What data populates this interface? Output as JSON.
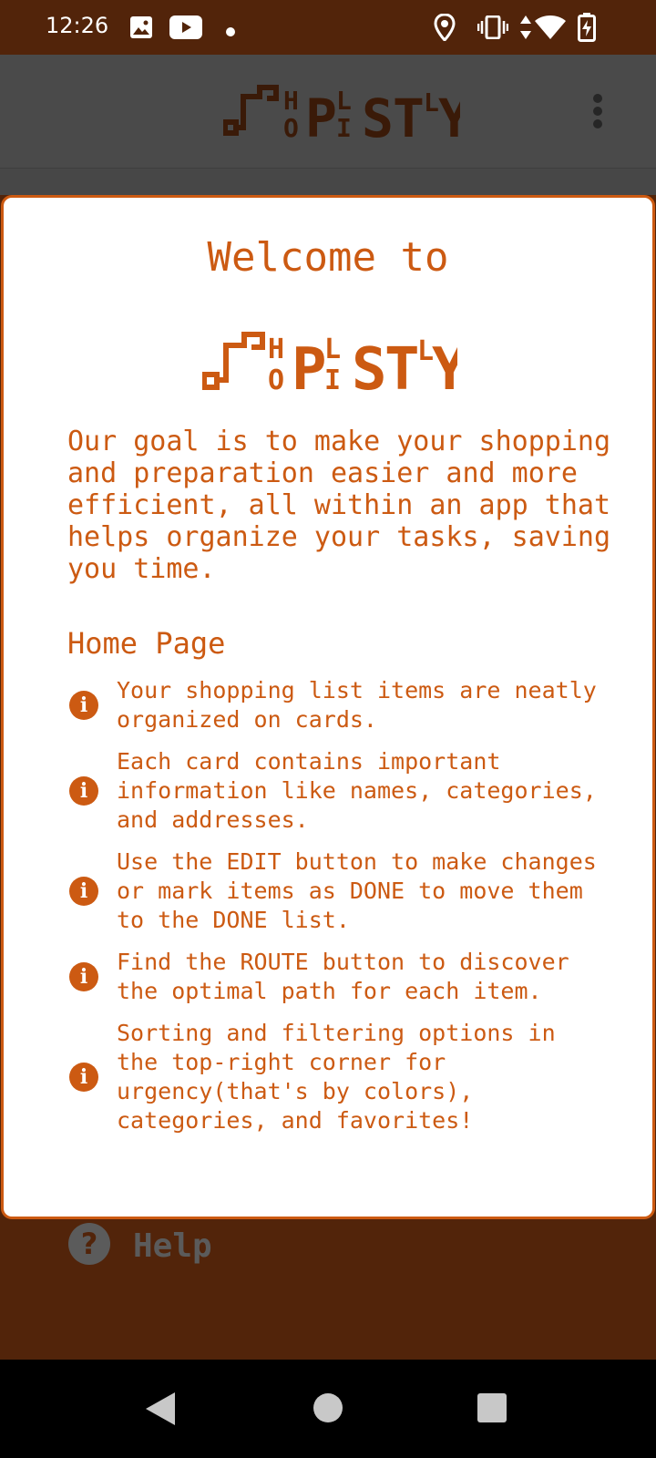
{
  "status_bar": {
    "time": "12:26",
    "left_icons": [
      "image-icon",
      "youtube-icon",
      "dot-icon"
    ],
    "right_icons": [
      "location-icon",
      "vibrate-icon",
      "data-arrows-icon",
      "wifi-icon",
      "battery-charging-icon"
    ]
  },
  "app_bar": {
    "logo_text": "SHOPLISTLY",
    "menu_icon": "more-vert-icon"
  },
  "dialog": {
    "title": "Welcome to",
    "logo_text": "SHOPLISTLY",
    "intro": "Our goal is to make your shopping and preparation easier and more efficient, all within an app that helps organize your tasks, saving you time.",
    "section_heading": "Home Page",
    "items": [
      {
        "icon": "info-icon",
        "text": "Your shopping list items are neatly organized on cards."
      },
      {
        "icon": "info-icon",
        "text": "Each card contains important information like names, categories, and addresses."
      },
      {
        "icon": "info-icon",
        "text": "Use the EDIT button to make changes or mark items as DONE to move them to the DONE list."
      },
      {
        "icon": "info-icon",
        "text": "Find the ROUTE button to discover the optimal path for each item."
      },
      {
        "icon": "info-icon",
        "text": "Sorting and filtering options in the top-right corner for urgency(that's by colors), categories, and favorites!"
      }
    ]
  },
  "background": {
    "help_label": "Help",
    "help_icon": "help-circle-icon"
  },
  "nav_bar": {
    "icons": [
      "back-icon",
      "home-icon",
      "recents-icon"
    ]
  },
  "colors": {
    "accent": "#cc5a12",
    "brand_dark": "#52240a",
    "scrim": "#4a4a4a"
  }
}
